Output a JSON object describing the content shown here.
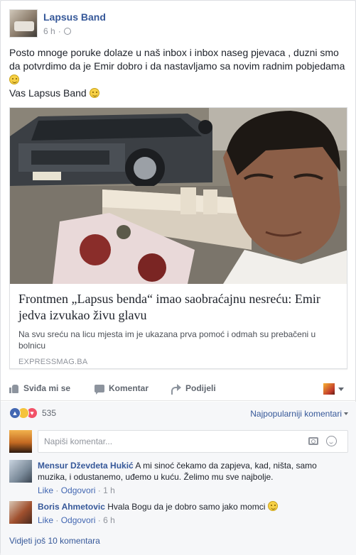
{
  "post": {
    "page_name": "Lapsus Band",
    "time": "6 h",
    "privacy_icon": "globe-icon",
    "text_line1": "Posto mnoge poruke dolaze u naš inbox i inbox naseg pjevaca , duzni smo da potvrdimo da je Emir dobro i da nastavljamo sa novim radnim pobjedama",
    "text_line2": "Vas Lapsus Band"
  },
  "link": {
    "title": "Frontmen „Lapsus benda“ imao saobraćajnu nesreću: Emir jedva izvukao živu glavu",
    "description": "Na svu sreću na licu mjesta im je ukazana prva pomoć i odmah su prebačeni u bolnicu",
    "domain": "EXPRESSMAG.BA"
  },
  "actions": {
    "like": "Sviđa mi se",
    "comment": "Komentar",
    "share": "Podijeli"
  },
  "reactions": {
    "count": "535",
    "types": [
      "like-icon",
      "sad-icon",
      "love-icon"
    ],
    "sort_label": "Najpopularniji komentari"
  },
  "composer": {
    "placeholder": "Napiši komentar..."
  },
  "comments": [
    {
      "author": "Mensur Dževdeta Hukić",
      "text": "A mi sinoć čekamo da zapjeva, kad, ništa, samo muzika, i odustanemo, uđemo u kuću. Želimo mu sve najbolje.",
      "like": "Like",
      "reply": "Odgovori",
      "time": "1 h"
    },
    {
      "author": "Boris Ahmetovic",
      "text": "Hvala Bogu da je dobro samo jako momci",
      "like": "Like",
      "reply": "Odgovori",
      "time": "6 h"
    }
  ],
  "more_comments": "Vidjeti još 10 komentara",
  "colors": {
    "link_blue": "#365899",
    "muted": "#90949c",
    "background_gray": "#f6f7f9"
  }
}
